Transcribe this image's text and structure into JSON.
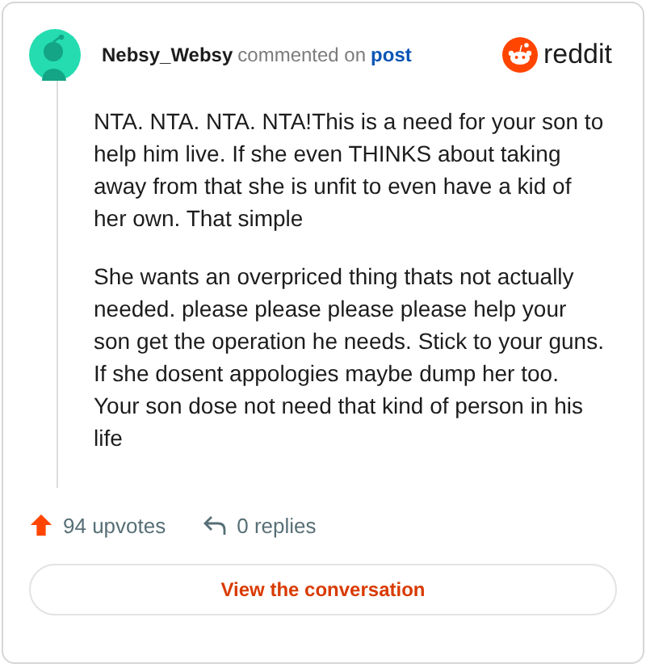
{
  "comment": {
    "author": "Nebsy_Websy",
    "action": "commented on",
    "link": "post",
    "paragraphs": [
      "NTA. NTA. NTA. NTA!This is a need for your son to help him live. If she even THINKS about taking away from that she is unfit to even have a kid of her own. That simple",
      "She wants an overpriced thing thats not actually needed. please please please please help your son get the operation he needs. Stick to your guns. If she dosent appologies maybe dump her too. Your son dose not need that kind of person in his life"
    ]
  },
  "brand": "reddit",
  "upvotes": "94 upvotes",
  "replies": "0 replies",
  "button": "View the conversation"
}
